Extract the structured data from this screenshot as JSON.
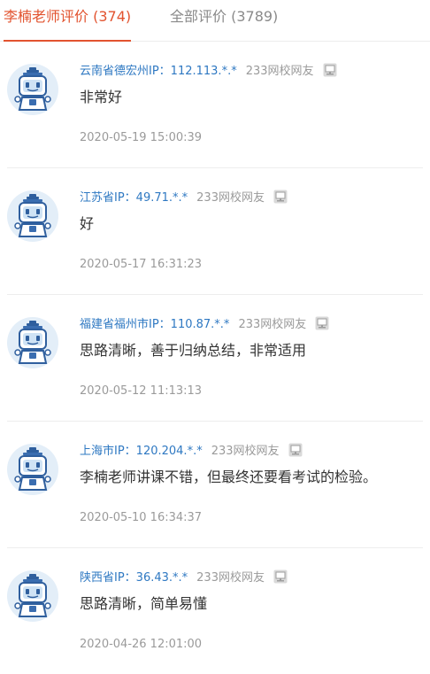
{
  "tabs": [
    {
      "label": "李楠老师评价 (374)",
      "active": true
    },
    {
      "label": "全部评价 (3789)",
      "active": false
    }
  ],
  "colors": {
    "accent": "#e2532f",
    "link": "#2e78c2",
    "muted": "#9a9a9a"
  },
  "reviews": [
    {
      "ip": "云南省德宏州IP：112.113.*.*",
      "source": "233网校网友",
      "text": "非常好",
      "time": "2020-05-19 15:00:39",
      "avatar_icon": "robot-avatar-icon",
      "device_icon": "computer-icon"
    },
    {
      "ip": "江苏省IP：49.71.*.*",
      "source": "233网校网友",
      "text": "好",
      "time": "2020-05-17 16:31:23",
      "avatar_icon": "robot-avatar-icon",
      "device_icon": "computer-icon"
    },
    {
      "ip": "福建省福州市IP：110.87.*.*",
      "source": "233网校网友",
      "text": "思路清晰，善于归纳总结，非常适用",
      "time": "2020-05-12 11:13:13",
      "avatar_icon": "robot-avatar-icon",
      "device_icon": "computer-icon"
    },
    {
      "ip": "上海市IP：120.204.*.*",
      "source": "233网校网友",
      "text": "李楠老师讲课不错，但最终还要看考试的检验。",
      "time": "2020-05-10 16:34:37",
      "avatar_icon": "robot-avatar-icon",
      "device_icon": "computer-icon"
    },
    {
      "ip": "陕西省IP：36.43.*.*",
      "source": "233网校网友",
      "text": "思路清晰，简单易懂",
      "time": "2020-04-26 12:01:00",
      "avatar_icon": "robot-avatar-icon",
      "device_icon": "computer-icon"
    }
  ]
}
